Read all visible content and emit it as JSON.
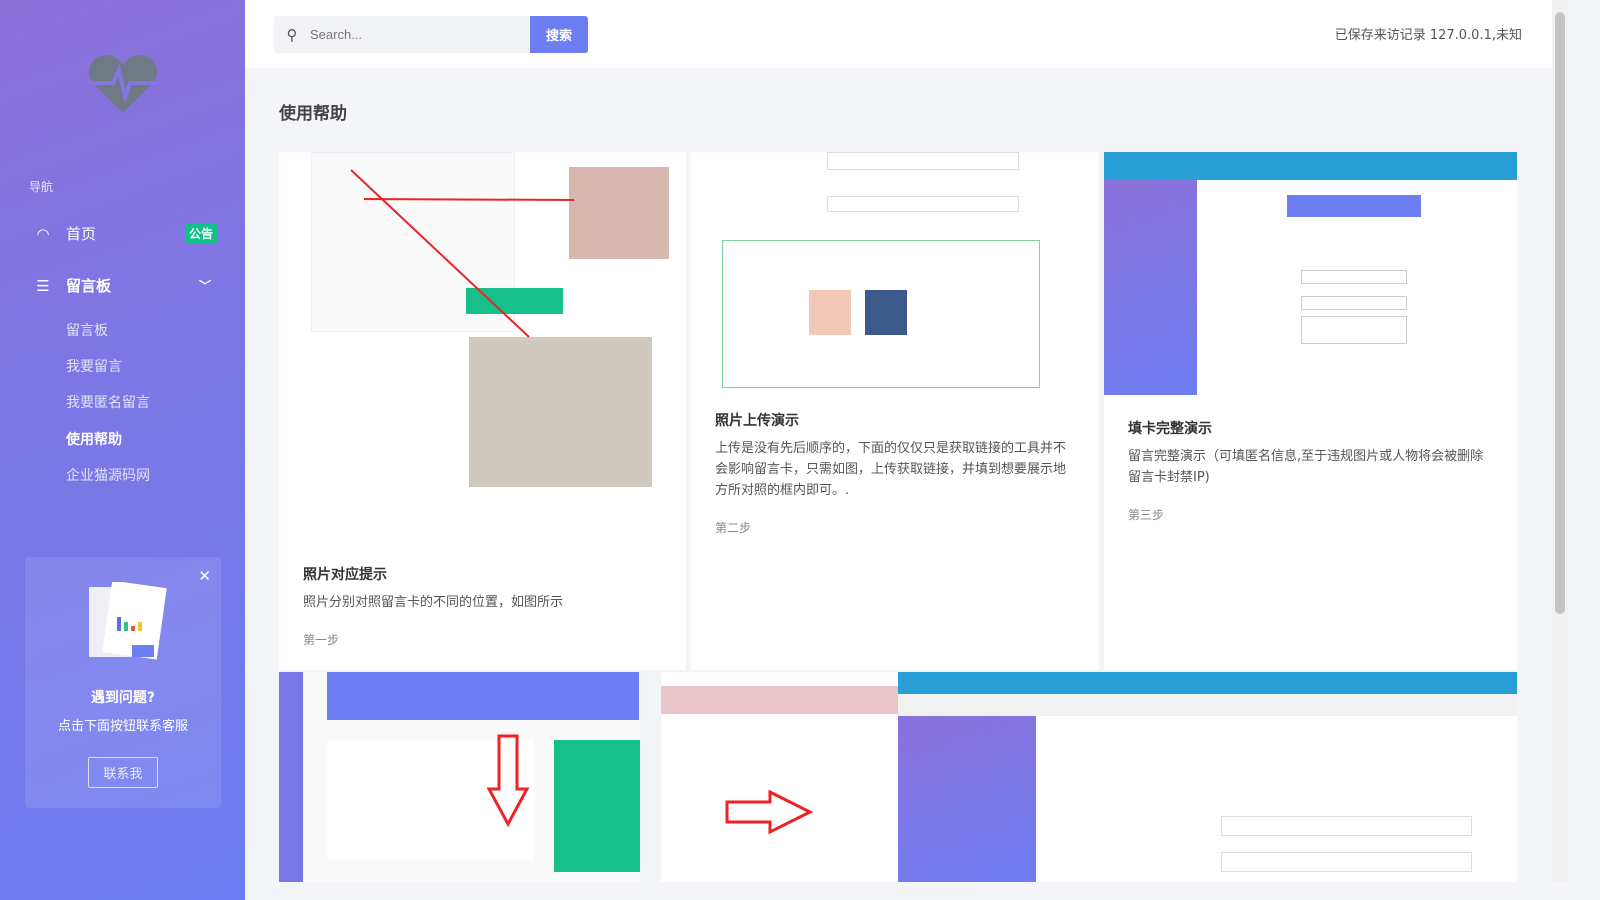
{
  "sidebar": {
    "nav_heading": "导航",
    "items": [
      {
        "label": "首页",
        "icon": "dashboard-icon",
        "badge": "公告"
      },
      {
        "label": "留言板",
        "icon": "list-icon"
      }
    ],
    "subitems": [
      "留言板",
      "我要留言",
      "我要匿名留言",
      "使用帮助",
      "企业猫源码网"
    ],
    "active_subitem": "使用帮助",
    "help": {
      "title": "遇到问题?",
      "text": "点击下面按钮联系客服",
      "button": "联系我"
    }
  },
  "header": {
    "search_placeholder": "Search...",
    "search_button": "搜索",
    "visit_text": "已保存来访记录 127.0.0.1,未知"
  },
  "page_title": "使用帮助",
  "cards": [
    {
      "title": "照片对应提示",
      "text": "照片分别对照留言卡的不同的位置，如图所示",
      "step": "第一步"
    },
    {
      "title": "照片上传演示",
      "text": "上传是没有先后顺序的，下面的仅仅只是获取链接的工具并不会影响留言卡，只需如图，上传获取链接，并填到想要展示地方所对照的框内即可。.",
      "step": "第二步"
    },
    {
      "title": "填卡完整演示",
      "text": "留言完整演示（可填匿名信息,至于违规图片或人物将会被删除留言卡封禁IP)",
      "step": "第三步"
    }
  ],
  "colors": {
    "accent": "#6d7ef2",
    "badge": "#12c08a"
  }
}
